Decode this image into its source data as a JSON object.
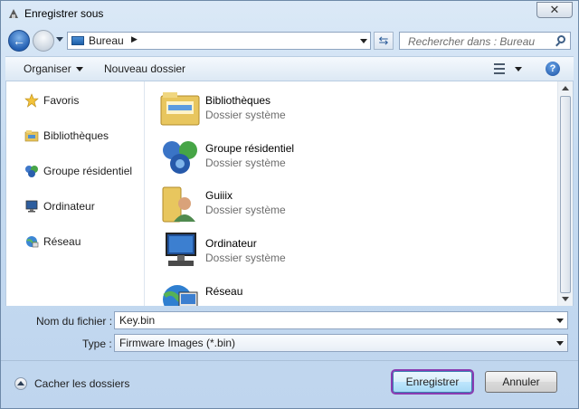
{
  "window": {
    "title": "Enregistrer sous",
    "close_label": "✕"
  },
  "nav": {
    "address": "Bureau",
    "address_chevron": "▶",
    "search_placeholder": "Rechercher dans : Bureau"
  },
  "toolbar": {
    "organize_label": "Organiser",
    "new_folder_label": "Nouveau dossier",
    "help_label": "?"
  },
  "sidebar": {
    "items": [
      {
        "label": "Favoris",
        "icon": "star-icon"
      },
      {
        "label": "Bibliothèques",
        "icon": "libraries-icon"
      },
      {
        "label": "Groupe résidentiel",
        "icon": "homegroup-icon"
      },
      {
        "label": "Ordinateur",
        "icon": "computer-icon"
      },
      {
        "label": "Réseau",
        "icon": "network-icon"
      }
    ]
  },
  "files": {
    "items": [
      {
        "name": "Bibliothèques",
        "type": "Dossier système",
        "icon": "libraries-folder-icon"
      },
      {
        "name": "Groupe résidentiel",
        "type": "Dossier système",
        "icon": "homegroup-icon"
      },
      {
        "name": "Guiiix",
        "type": "Dossier système",
        "icon": "user-folder-icon"
      },
      {
        "name": "Ordinateur",
        "type": "Dossier système",
        "icon": "computer-icon"
      },
      {
        "name": "Réseau",
        "type": "",
        "icon": "network-icon"
      }
    ]
  },
  "form": {
    "filename_label": "Nom du fichier :",
    "filename_value": "Key.bin",
    "type_label": "Type :",
    "type_value": "Firmware Images (*.bin)"
  },
  "footer": {
    "hide_folders_label": "Cacher les dossiers",
    "save_label": "Enregistrer",
    "cancel_label": "Annuler"
  },
  "colors": {
    "accent": "#2460b3",
    "focus_outline": "#8a3bb2"
  }
}
